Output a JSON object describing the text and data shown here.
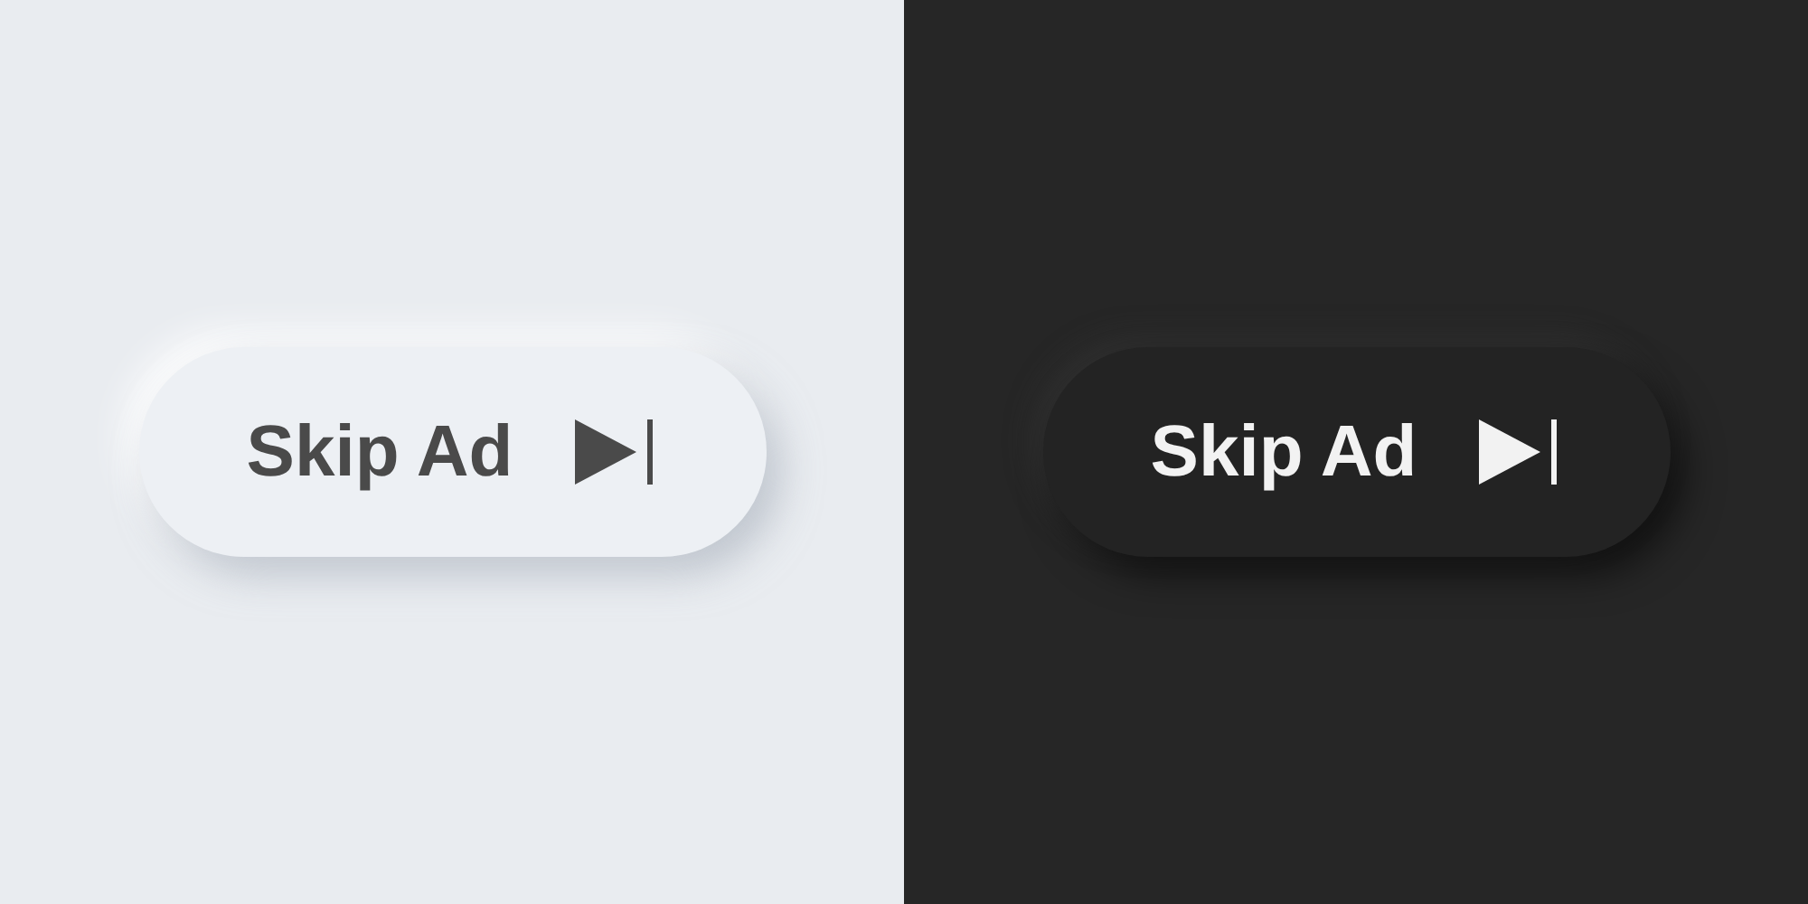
{
  "panels": [
    {
      "kind": "light",
      "button": {
        "label": "Skip Ad"
      }
    },
    {
      "kind": "dark",
      "button": {
        "label": "Skip Ad"
      }
    }
  ]
}
